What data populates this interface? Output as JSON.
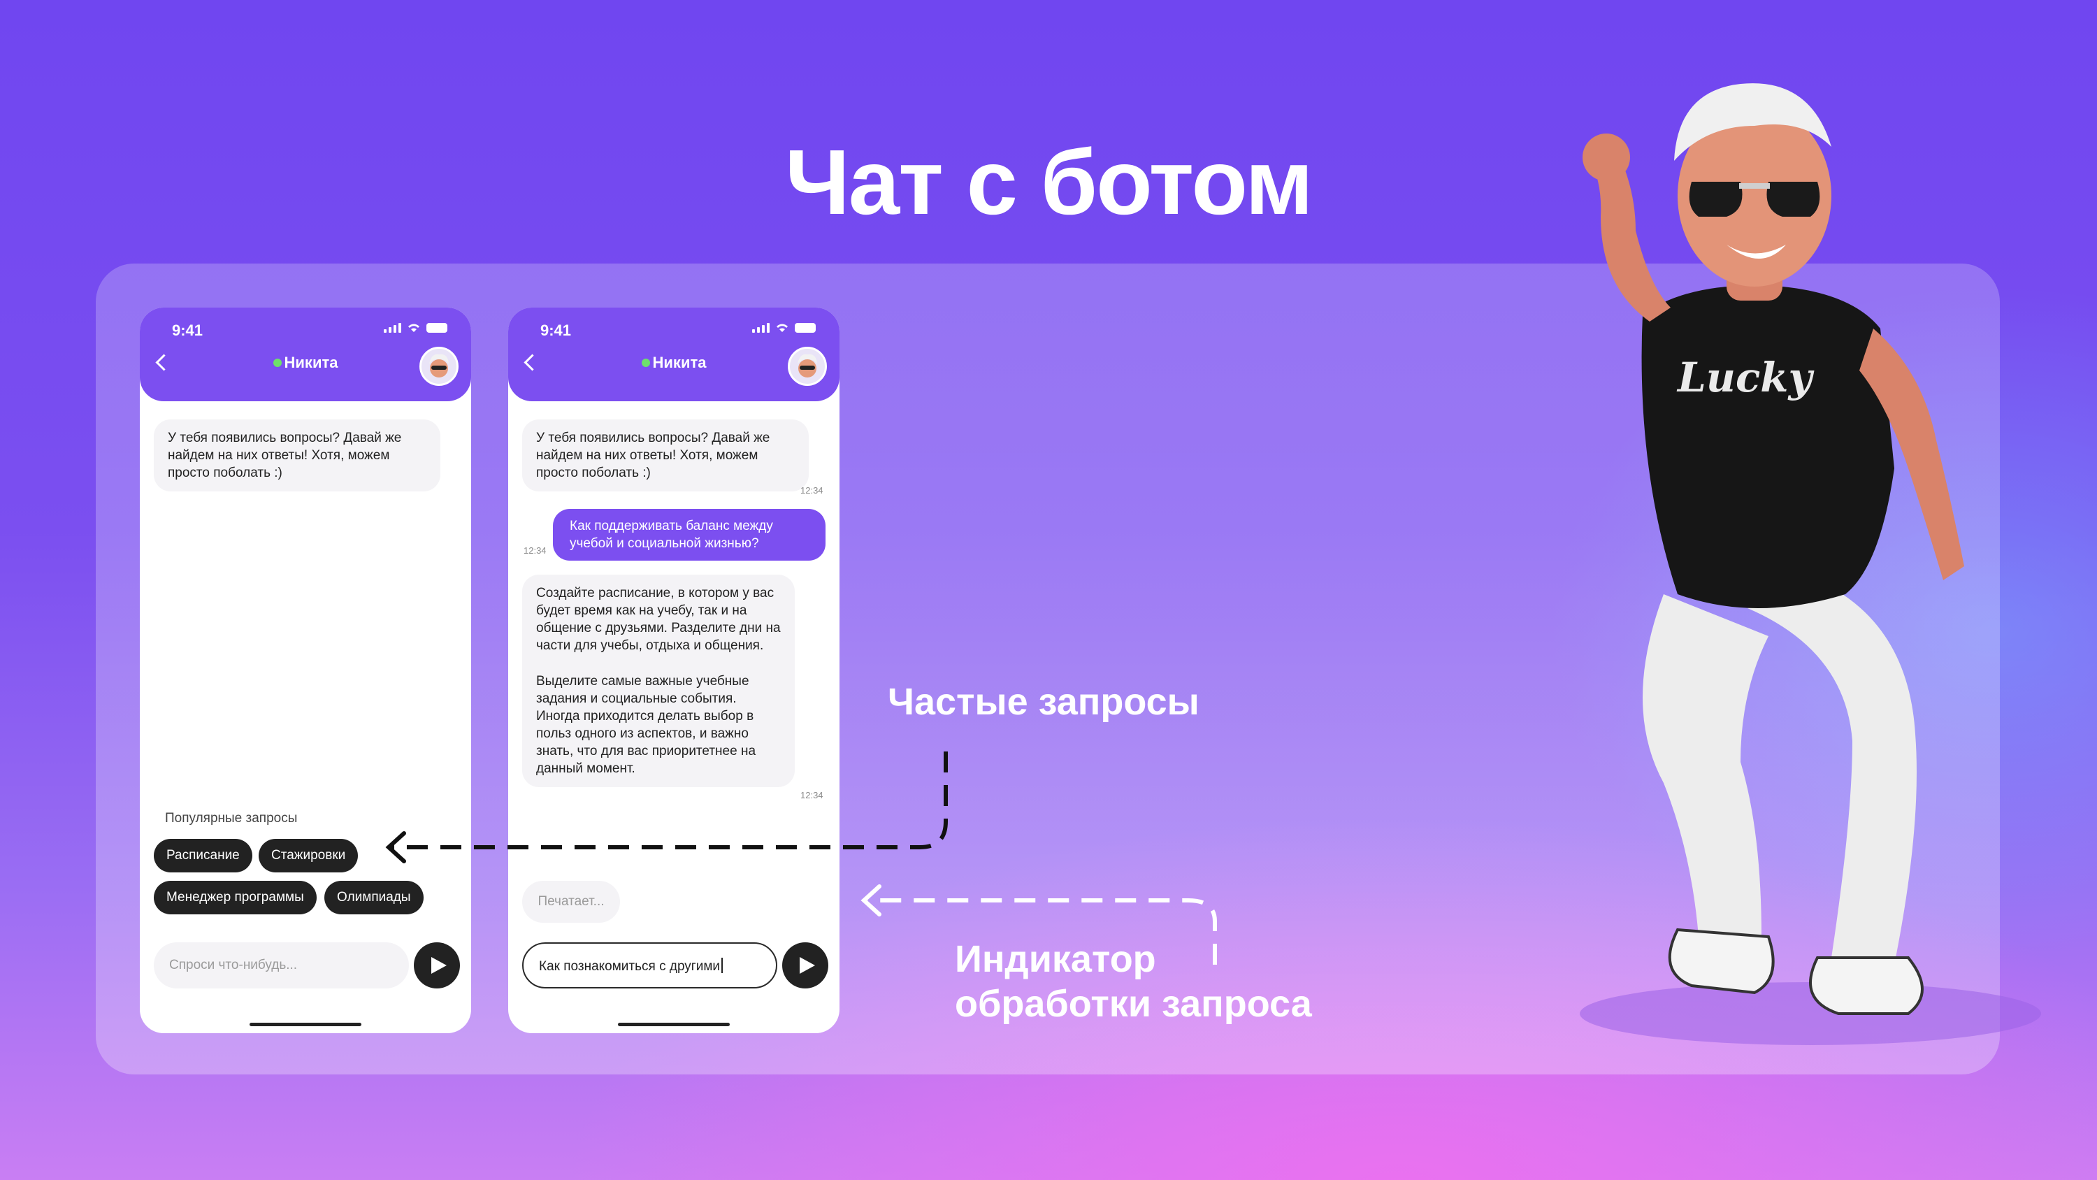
{
  "title": "Чат с ботом",
  "phone_left": {
    "time": "9:41",
    "contact_name": "Никита",
    "messages": [
      {
        "from": "bot",
        "text": "У тебя появились вопросы? Давай же найдем на них ответы! Хотя, можем просто поболать :)"
      }
    ],
    "popular_label": "Популярные запросы",
    "chips": [
      "Расписание",
      "Стажировки",
      "Менеджер программы",
      "Олимпиады"
    ],
    "input_placeholder": "Спроси что-нибудь..."
  },
  "phone_right": {
    "time": "9:41",
    "contact_name": "Никита",
    "messages": [
      {
        "from": "bot",
        "text": "У тебя появились вопросы? Давай же найдем на них ответы! Хотя, можем просто поболать :)",
        "time": "12:34"
      },
      {
        "from": "user",
        "text": "Как поддерживать баланс между учебой и социальной жизнью?",
        "time": "12:34"
      },
      {
        "from": "bot",
        "text_p1": "Создайте расписание, в котором у вас будет время как на учебу, так и на общение с друзьями. Разделите дни на части для учебы, отдыха и общения.",
        "text_p2": "Выделите самые важные учебные задания и социальные события. Иногда приходится делать выбор в польз одного из аспектов, и важно знать, что для вас приоритетнее на данный момент.",
        "time": "12:34"
      }
    ],
    "typing_text": "Печатает...",
    "input_value": "Как познакомиться с другими"
  },
  "annotations": {
    "frequent_requests": "Частые запросы",
    "indicator_line1": "Индикатор",
    "indicator_line2": "обработки запроса"
  },
  "colors": {
    "accent": "#7c4ff0",
    "bubble_bot": "#f4f3f6",
    "online": "#6ee06a"
  }
}
